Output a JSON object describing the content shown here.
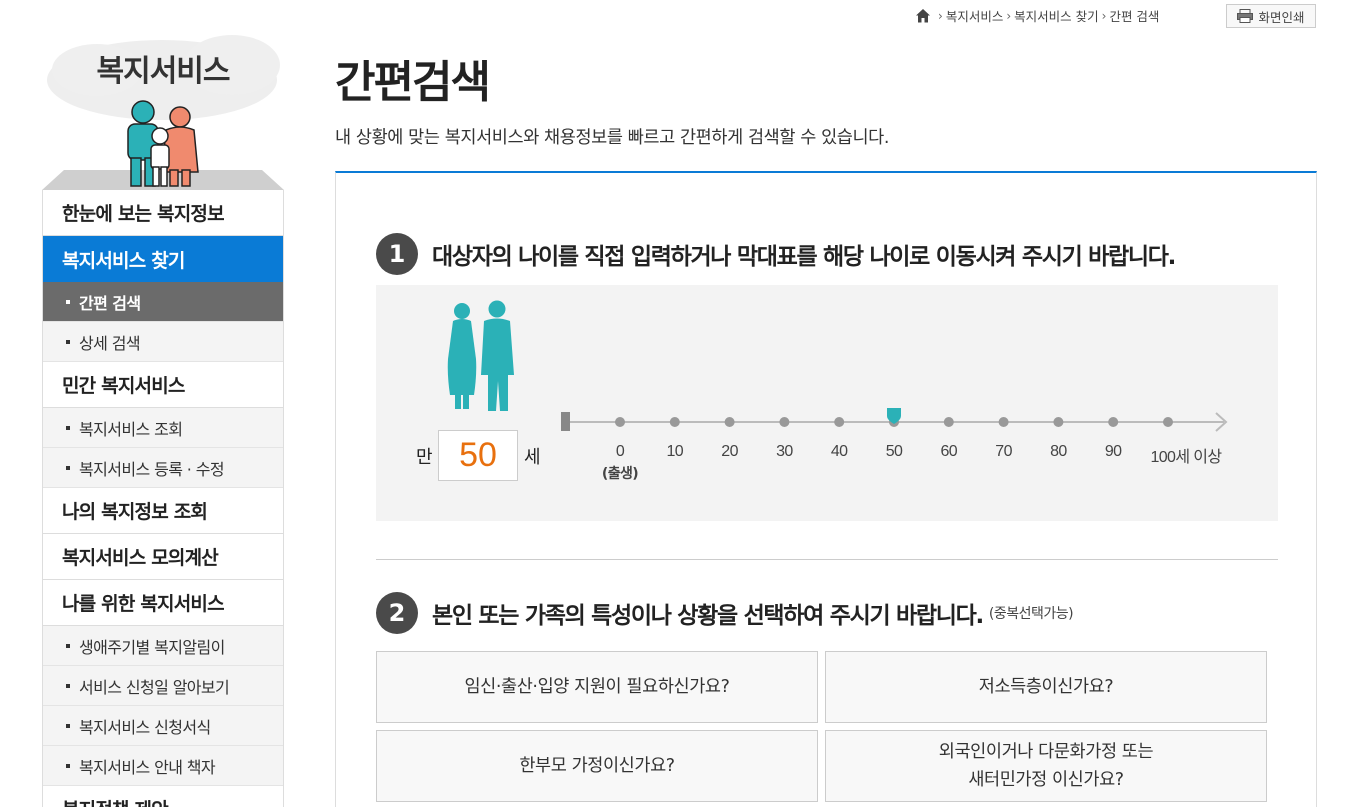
{
  "breadcrumb": {
    "items": [
      "복지서비스",
      "복지서비스 찾기",
      "간편 검색"
    ]
  },
  "print_label": "화면인쇄",
  "sidebar": {
    "title": "복지서비스",
    "menu": [
      {
        "label": "한눈에 보는 복지정보",
        "level": 1
      },
      {
        "label": "복지서비스 찾기",
        "level": 1,
        "active": true
      },
      {
        "label": "간편 검색",
        "level": 2,
        "active": true
      },
      {
        "label": "상세 검색",
        "level": 2
      },
      {
        "label": "민간 복지서비스",
        "level": 1
      },
      {
        "label": "복지서비스 조회",
        "level": 2
      },
      {
        "label": "복지서비스 등록 · 수정",
        "level": 2
      },
      {
        "label": "나의 복지정보 조회",
        "level": 1
      },
      {
        "label": "복지서비스 모의계산",
        "level": 1
      },
      {
        "label": "나를 위한 복지서비스",
        "level": 1
      },
      {
        "label": "생애주기별 복지알림이",
        "level": 2
      },
      {
        "label": "서비스 신청일 알아보기",
        "level": 2
      },
      {
        "label": "복지서비스 신청서식",
        "level": 2
      },
      {
        "label": "복지서비스 안내 책자",
        "level": 2
      },
      {
        "label": "복지정책 제안",
        "level": 1
      }
    ]
  },
  "main": {
    "title": "간편검색",
    "description": "내 상황에 맞는 복지서비스와 채용정보를 빠르고 간편하게 검색할 수 있습니다.",
    "step1": {
      "number": "1",
      "text": "대상자의 나이를 직접 입력하거나 막대표를 해당 나이로 이동시켜 주시기 바랍니다.",
      "prefix": "만",
      "suffix": "세",
      "age_value": "50",
      "ticks": [
        "0",
        "10",
        "20",
        "30",
        "40",
        "50",
        "60",
        "70",
        "80",
        "90",
        "100세 이상"
      ],
      "tick_sub": "(출생)",
      "slider_value": 50
    },
    "step2": {
      "number": "2",
      "text": "본인 또는 가족의 특성이나 상황을 선택하여 주시기 바랍니다.",
      "note": "(중복선택가능)",
      "options": [
        "임신·출산·입양 지원이 필요하신가요?",
        "저소득층이신가요?",
        "한부모 가정이신가요?",
        "외국인이거나 다문화가정 또는\n새터민가정 이신가요?"
      ]
    }
  },
  "colors": {
    "accent": "#0a7bd6",
    "figure": "#2bb1b7",
    "age": "#e8700e"
  }
}
